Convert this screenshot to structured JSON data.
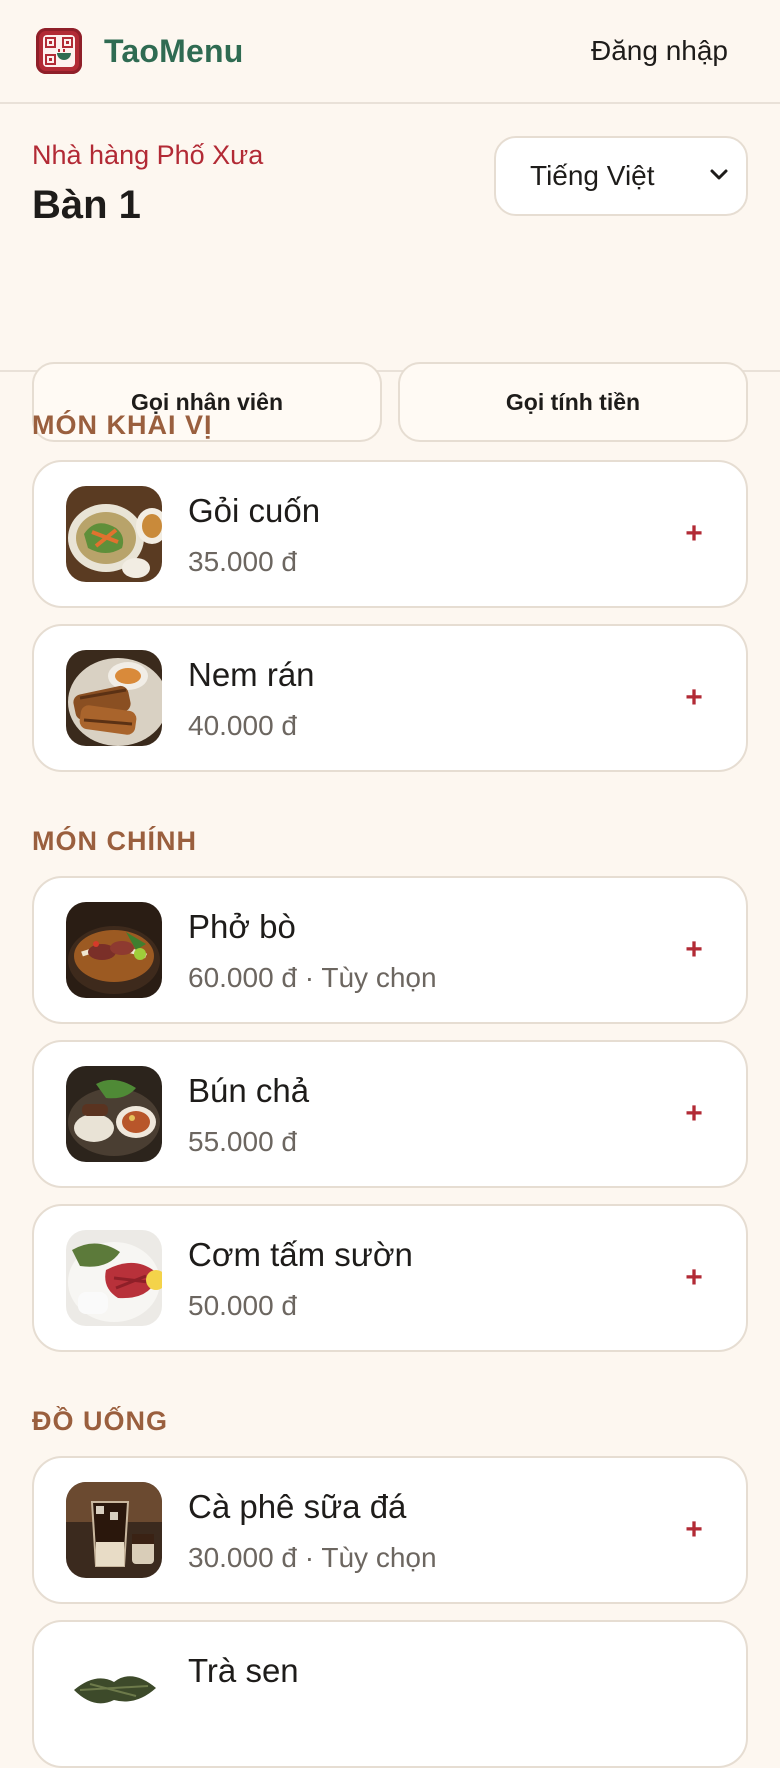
{
  "topbar": {
    "brand": "TaoMenu",
    "login": "Đăng nhập"
  },
  "header": {
    "restaurant": "Nhà hàng Phố Xưa",
    "table": "Bàn 1",
    "language": "Tiếng Việt",
    "call_staff": "Gọi nhân viên",
    "call_bill": "Gọi tính tiền"
  },
  "sections": [
    {
      "title": "MÓN KHAI VỊ",
      "items": [
        {
          "name": "Gỏi cuốn",
          "meta": "35.000 đ",
          "add": "+"
        },
        {
          "name": "Nem rán",
          "meta": "40.000 đ",
          "add": "+"
        }
      ]
    },
    {
      "title": "MÓN CHÍNH",
      "items": [
        {
          "name": "Phở bò",
          "meta": "60.000 đ · Tùy chọn",
          "add": "+"
        },
        {
          "name": "Bún chả",
          "meta": "55.000 đ",
          "add": "+"
        },
        {
          "name": "Cơm tấm sườn",
          "meta": "50.000 đ",
          "add": "+"
        }
      ]
    },
    {
      "title": "ĐỒ UỐNG",
      "items": [
        {
          "name": "Cà phê sữa đá",
          "meta": "30.000 đ · Tùy chọn",
          "add": "+"
        },
        {
          "name": "Trà sen",
          "meta": "",
          "add": ""
        }
      ]
    }
  ],
  "colors": {
    "accent": "#b22a35",
    "brand": "#2f6b52",
    "section": "#9a5f3e",
    "background": "#fdf7f0"
  },
  "icons": {
    "logo": "qr-bowl-logo-icon",
    "select": "chevron-down-icon",
    "add": "plus-icon"
  }
}
